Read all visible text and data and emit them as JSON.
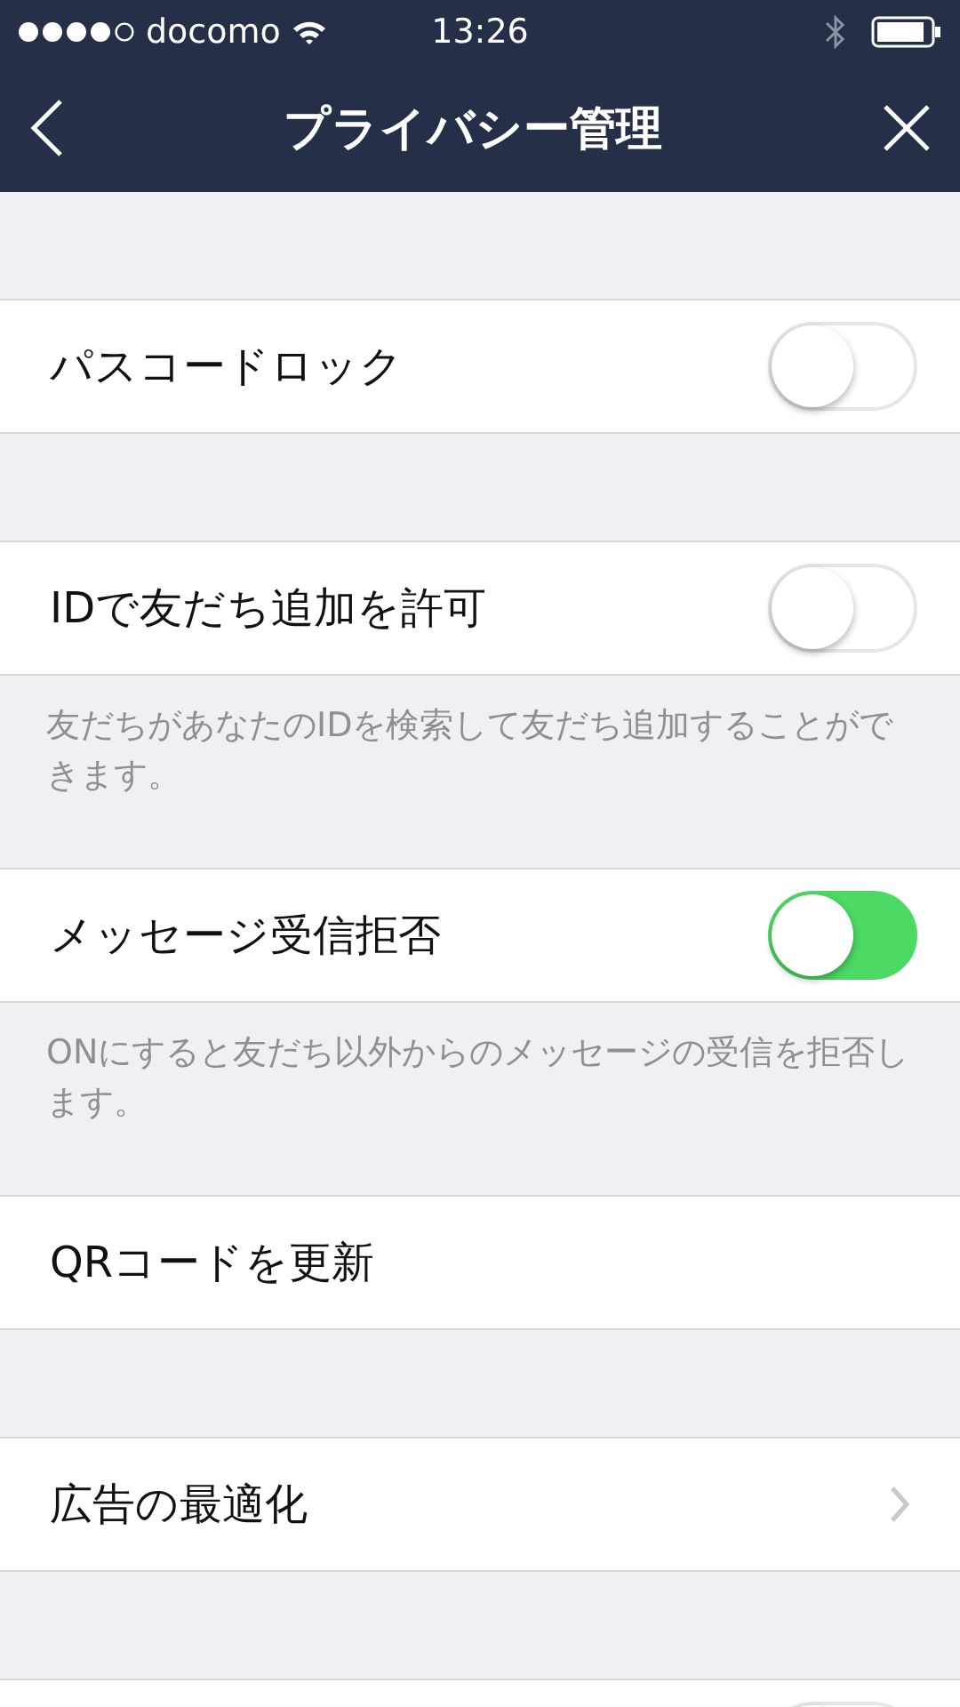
{
  "status_bar": {
    "carrier": "docomo",
    "time": "13:26"
  },
  "nav": {
    "title": "プライバシー管理"
  },
  "sections": [
    {
      "rows": [
        {
          "kind": "toggle",
          "label": "パスコードロック",
          "on": false
        }
      ]
    },
    {
      "rows": [
        {
          "kind": "toggle",
          "label": "IDで友だち追加を許可",
          "on": false
        }
      ],
      "note": "友だちがあなたのIDを検索して友だち追加することができます。"
    },
    {
      "rows": [
        {
          "kind": "toggle",
          "label": "メッセージ受信拒否",
          "on": true
        }
      ],
      "note": "ONにすると友だち以外からのメッセージの受信を拒否します。"
    },
    {
      "rows": [
        {
          "kind": "action",
          "label": "QRコードを更新"
        }
      ]
    },
    {
      "rows": [
        {
          "kind": "link",
          "label": "広告の最適化"
        }
      ]
    },
    {
      "rows": [
        {
          "kind": "toggle",
          "on": false
        }
      ]
    }
  ]
}
